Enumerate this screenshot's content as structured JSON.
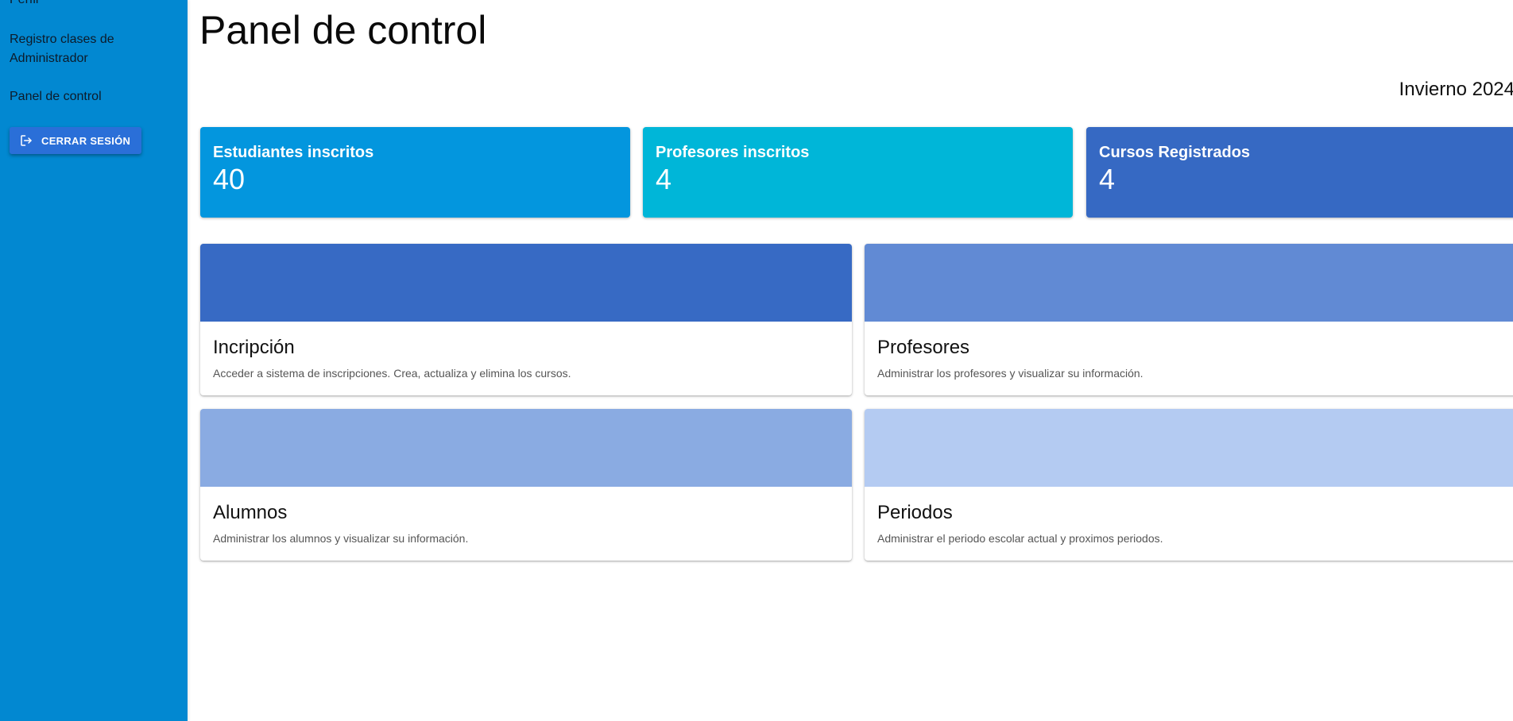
{
  "sidebar": {
    "items": [
      {
        "label": "Perfil"
      },
      {
        "label": "Registro clases de Administrador"
      },
      {
        "label": "Panel de control"
      }
    ],
    "logout_label": "CERRAR SESIÓN",
    "logout_icon": "logout-icon",
    "background_color": "#0288d1"
  },
  "header": {
    "title": "Panel de control",
    "period": "Invierno 2024"
  },
  "stats": [
    {
      "label": "Estudiantes inscritos",
      "value": "40",
      "color": "#0396de"
    },
    {
      "label": "Profesores inscritos",
      "value": "4",
      "color": "#00b6d8"
    },
    {
      "label": "Cursos Registrados",
      "value": "4",
      "color": "#3669c3"
    }
  ],
  "cards": [
    {
      "title": "Incripción",
      "description": "Acceder a sistema de inscripciones. Crea, actualiza y elimina los cursos.",
      "color": "#376ac4"
    },
    {
      "title": "Profesores",
      "description": "Administrar los profesores y visualizar su información.",
      "color": "#618ad4"
    },
    {
      "title": "Alumnos",
      "description": "Administrar los alumnos y visualizar su información.",
      "color": "#8aabe2"
    },
    {
      "title": "Periodos",
      "description": "Administrar el periodo escolar actual y proximos periodos.",
      "color": "#b4cbf2"
    }
  ]
}
